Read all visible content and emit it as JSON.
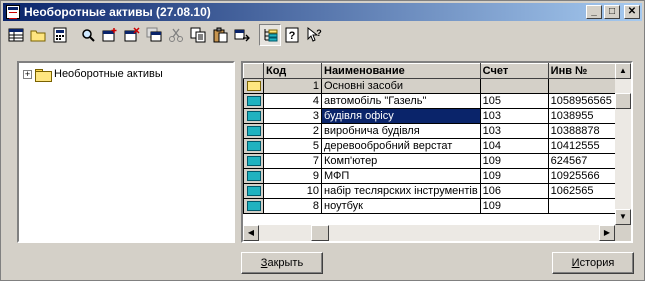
{
  "window": {
    "title": "Необоротные активы (27.08.10)",
    "app_icon": "form-icon",
    "controls": {
      "minimize": "_",
      "maximize": "□",
      "close": "✕"
    }
  },
  "toolbar": {
    "items": [
      {
        "icon": "table-icon"
      },
      {
        "icon": "folder-icon"
      },
      {
        "icon": "calculator-icon"
      },
      {
        "icon": "find-icon"
      },
      {
        "icon": "add-row-icon"
      },
      {
        "icon": "delete-row-icon"
      },
      {
        "icon": "copy-row-icon"
      },
      {
        "icon": "cut-icon"
      },
      {
        "icon": "copy-icon"
      },
      {
        "icon": "paste-icon"
      },
      {
        "icon": "move-icon"
      },
      {
        "icon": "tree-view-icon",
        "active": true
      },
      {
        "icon": "help-icon",
        "label": "?"
      },
      {
        "icon": "context-help-icon",
        "label": "?"
      }
    ]
  },
  "tree": {
    "expander": "+",
    "root_label": "Необоротные активы"
  },
  "grid": {
    "columns": [
      "Код",
      "Наименование",
      "Счет",
      "Инв №"
    ],
    "rows": [
      {
        "kind": "group",
        "code": "1",
        "name": "Основні засоби",
        "account": "",
        "inv": ""
      },
      {
        "kind": "item",
        "code": "4",
        "name": "автомобіль \"Газель\"",
        "account": "105",
        "inv": "1058956565"
      },
      {
        "kind": "item",
        "code": "3",
        "name": "будівля офісу",
        "account": "103",
        "inv": "1038955",
        "selected": true
      },
      {
        "kind": "item",
        "code": "2",
        "name": "виробнича будівля",
        "account": "103",
        "inv": "10388878"
      },
      {
        "kind": "item",
        "code": "5",
        "name": "деревообробний верстат",
        "account": "104",
        "inv": "10412555"
      },
      {
        "kind": "item",
        "code": "7",
        "name": "Комп'ютер",
        "account": "109",
        "inv": "624567"
      },
      {
        "kind": "item",
        "code": "9",
        "name": "МФП",
        "account": "109",
        "inv": "10925566"
      },
      {
        "kind": "item",
        "code": "10",
        "name": "набір теслярских інструментів",
        "account": "106",
        "inv": "1062565"
      },
      {
        "kind": "item",
        "code": "8",
        "name": "ноутбук",
        "account": "109",
        "inv": ""
      }
    ]
  },
  "buttons": {
    "close": {
      "mnemonic": "З",
      "rest": "акрыть"
    },
    "history": {
      "mnemonic": "И",
      "rest": "стория"
    }
  },
  "colors": {
    "title_start": "#0a246a",
    "title_end": "#a6caf0",
    "selection": "#0a246a",
    "face": "#d4d0c8"
  }
}
